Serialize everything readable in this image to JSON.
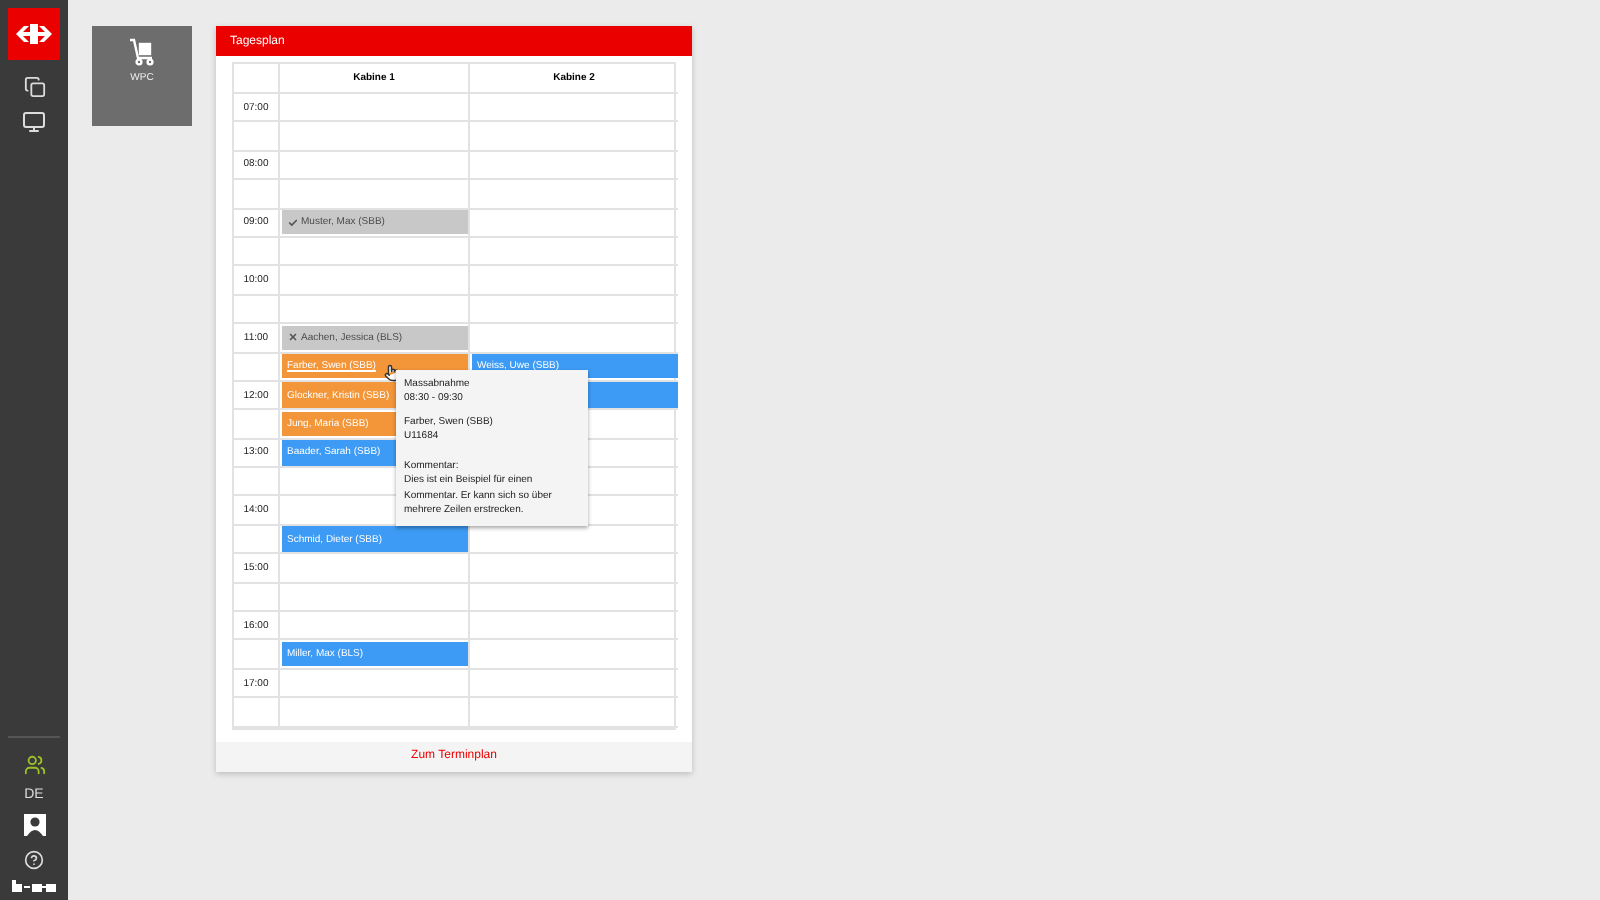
{
  "sidebar": {
    "language": "DE"
  },
  "tile": {
    "label": "WPC"
  },
  "panel": {
    "title": "Tagesplan",
    "footer_link": "Zum Terminplan"
  },
  "table": {
    "columns": [
      "Kabine 1",
      "Kabine 2"
    ],
    "rows": [
      {
        "time": "07:00",
        "cells": [
          null,
          null
        ]
      },
      {
        "time": "",
        "cells": [
          null,
          null
        ]
      },
      {
        "time": "08:00",
        "cells": [
          null,
          null
        ]
      },
      {
        "time": "",
        "cells": [
          null,
          null
        ]
      },
      {
        "time": "09:00",
        "cells": [
          {
            "kind": "done",
            "name": "Muster, Max (SBB)",
            "color": "#c8c8c8"
          },
          null
        ]
      },
      {
        "time": "",
        "cells": [
          null,
          null
        ]
      },
      {
        "time": "10:00",
        "cells": [
          null,
          null
        ]
      },
      {
        "time": "",
        "cells": [
          null,
          null
        ]
      },
      {
        "time": "11:00",
        "cells": [
          {
            "kind": "cancelled",
            "name": "Aachen, Jessica (BLS)",
            "color": "#c8c8c8"
          },
          null
        ]
      },
      {
        "time": "",
        "cells": [
          {
            "kind": "booking",
            "name": "Farber, Swen (SBB)",
            "color": "#f39639",
            "hovered": true
          },
          {
            "kind": "booking",
            "name": "Weiss, Uwe (SBB)",
            "color": "#3d9bf5"
          }
        ]
      },
      {
        "time": "12:00",
        "cells": [
          {
            "kind": "booking",
            "name": "Glockner, Kristin (SBB)",
            "color": "#f39639"
          },
          {
            "kind": "continued",
            "color": "#3d9bf5"
          }
        ]
      },
      {
        "time": "",
        "cells": [
          {
            "kind": "booking",
            "name": "Jung, Maria (SBB)",
            "color": "#f39639"
          },
          null
        ]
      },
      {
        "time": "13:00",
        "cells": [
          {
            "kind": "booking",
            "name": "Baader, Sarah (SBB)",
            "color": "#3d9bf5"
          },
          null
        ]
      },
      {
        "time": "",
        "cells": [
          null,
          null
        ]
      },
      {
        "time": "14:00",
        "cells": [
          null,
          null
        ]
      },
      {
        "time": "",
        "cells": [
          {
            "kind": "booking",
            "name": "Schmid, Dieter (SBB)",
            "color": "#3d9bf5"
          },
          null
        ]
      },
      {
        "time": "15:00",
        "cells": [
          null,
          null
        ]
      },
      {
        "time": "",
        "cells": [
          null,
          null
        ]
      },
      {
        "time": "16:00",
        "cells": [
          null,
          null
        ]
      },
      {
        "time": "",
        "cells": [
          {
            "kind": "booking",
            "name": "Miller, Max (BLS)",
            "color": "#3d9bf5"
          },
          null
        ]
      },
      {
        "time": "17:00",
        "cells": [
          null,
          null
        ]
      },
      {
        "time": "",
        "cells": [
          null,
          null
        ]
      }
    ]
  },
  "tooltip": {
    "title": "Massabnahme",
    "time": "08:30 - 09:30",
    "person": "Farber, Swen (SBB)",
    "id": "U11684",
    "comment_label": "Kommentar:",
    "comment": "Dies ist ein Beispiel für einen Kommentar. Er kann sich so über mehrere Zeilen erstrecken."
  }
}
